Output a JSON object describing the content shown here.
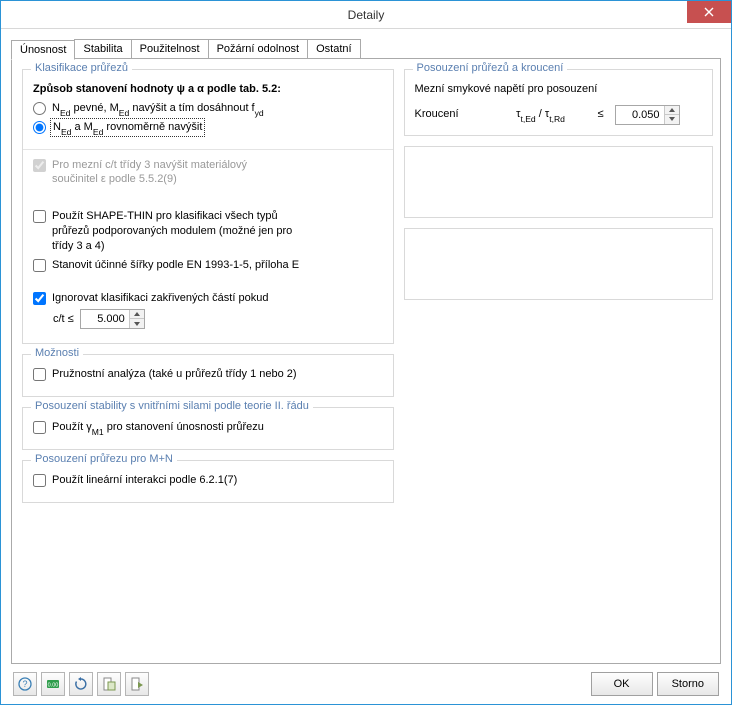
{
  "window": {
    "title": "Detaily"
  },
  "tabs": [
    "Únosnost",
    "Stabilita",
    "Použitelnost",
    "Požární odolnost",
    "Ostatní"
  ],
  "left": {
    "klasifikace": {
      "title": "Klasifikace průřezů",
      "heading": "Způsob stanovení hodnoty ψ a α podle tab. 5.2:",
      "opt1_pre": "N",
      "opt1_sub1": "Ed",
      "opt1_mid": " pevné, M",
      "opt1_sub2": "Ed",
      "opt1_post": " navýšit a tím dosáhnout f",
      "opt1_sub3": "yd",
      "opt2_pre": "N",
      "opt2_sub1": "Ed",
      "opt2_mid": " a M",
      "opt2_sub2": "Ed",
      "opt2_post": " rovnoměrně navýšit",
      "chk_material_l1": "Pro mezní c/t třídy 3 navýšit materiálový",
      "chk_material_l2": "součinitel ε podle 5.5.2(9)",
      "chk_shape_l1": "Použít SHAPE-THIN pro klasifikaci všech typů",
      "chk_shape_l2": "průřezů podporovaných modulem (možné jen pro",
      "chk_shape_l3": "třídy 3 a 4)",
      "chk_effwidth": "Stanovit účinné šířky podle EN 1993-1-5, příloha E",
      "chk_ignore": "Ignorovat klasifikaci zakřivených částí pokud",
      "ct_label": "c/t ≤",
      "ct_value": "5.000"
    },
    "moznosti": {
      "title": "Možnosti",
      "chk": "Pružnostní analýza (také u průřezů třídy 1 nebo 2)"
    },
    "stabilita": {
      "title": "Posouzení stability s vnitřními silami podle teorie II. řádu",
      "chk_pre": "Použít γ",
      "chk_sub": "M1",
      "chk_post": " pro stanovení únosnosti průřezu"
    },
    "mn": {
      "title": "Posouzení průřezu pro M+N",
      "chk": "Použít lineární interakci podle 6.2.1(7)"
    }
  },
  "right": {
    "torsion": {
      "title": "Posouzení průřezů a kroucení",
      "subtitle": "Mezní smykové napětí pro posouzení",
      "label": "Kroucení",
      "ratio_pre": "τ",
      "ratio_sub1": "t,Ed",
      "ratio_mid": " / τ",
      "ratio_sub2": "t,Rd",
      "le": "≤",
      "value": "0.050"
    }
  },
  "buttons": {
    "ok": "OK",
    "cancel": "Storno"
  }
}
